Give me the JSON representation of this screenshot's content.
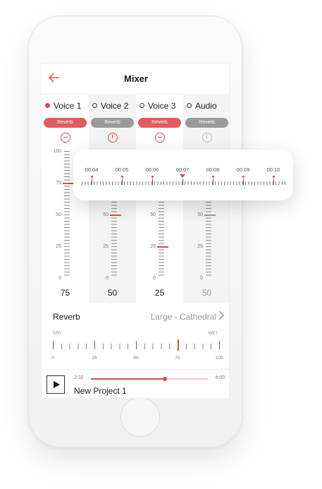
{
  "header": {
    "title": "Mixer",
    "back_icon": "arrow-left-icon"
  },
  "channels": [
    {
      "name": "Voice 1",
      "active": true,
      "reverb_label": "Reverb",
      "reverb_on": true,
      "value": "75",
      "level": 75
    },
    {
      "name": "Voice 2",
      "active": false,
      "reverb_label": "Reverb",
      "reverb_on": false,
      "value": "50",
      "level": 50
    },
    {
      "name": "Voice 3",
      "active": false,
      "reverb_label": "Reverb",
      "reverb_on": true,
      "value": "25",
      "level": 25
    },
    {
      "name": "Audio",
      "active": false,
      "reverb_label": "Reverb",
      "reverb_on": false,
      "value": "50",
      "level": 50
    }
  ],
  "scale_labels": [
    "100",
    "75",
    "50",
    "25",
    "0"
  ],
  "timeline": {
    "labels": [
      "00:04",
      "00:05",
      "00:06",
      "00:07",
      "00:08",
      "00:09",
      "00:10"
    ],
    "current": "00:07"
  },
  "reverb": {
    "label": "Reverb",
    "value": "Large - Cathedral",
    "dry_label": "DRY",
    "wet_label": "WET",
    "scale": [
      "0",
      "25",
      "50",
      "75",
      "100"
    ],
    "level": 75
  },
  "player": {
    "elapsed": "2:32",
    "total": "4:00",
    "progress": 0.63,
    "project": "New Project 1"
  },
  "colors": {
    "accent": "#e0474c",
    "pill_off": "#9a9a9a",
    "channel_bg": "#f4f4f4"
  }
}
